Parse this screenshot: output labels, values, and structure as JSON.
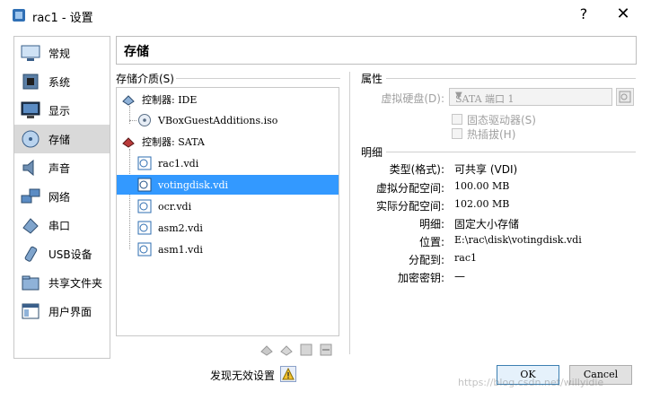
{
  "window": {
    "title": "rac1 - 设置",
    "help_label": "?",
    "close_label": "✕"
  },
  "sidebar": {
    "items": [
      {
        "label": "常规",
        "icon": "general-icon"
      },
      {
        "label": "系统",
        "icon": "system-icon"
      },
      {
        "label": "显示",
        "icon": "display-icon"
      },
      {
        "label": "存储",
        "icon": "storage-icon",
        "selected": true
      },
      {
        "label": "声音",
        "icon": "audio-icon"
      },
      {
        "label": "网络",
        "icon": "network-icon"
      },
      {
        "label": "串口",
        "icon": "serial-port-icon"
      },
      {
        "label": "USB设备",
        "icon": "usb-icon"
      },
      {
        "label": "共享文件夹",
        "icon": "shared-folder-icon"
      },
      {
        "label": "用户界面",
        "icon": "user-interface-icon"
      }
    ]
  },
  "page": {
    "title": "存储"
  },
  "storage": {
    "label": "存储介质(S)",
    "tree": [
      {
        "text": "控制器: IDE",
        "kind": "controller"
      },
      {
        "text": "VBoxGuestAdditions.iso",
        "kind": "optical"
      },
      {
        "text": "控制器: SATA",
        "kind": "controller"
      },
      {
        "text": "rac1.vdi",
        "kind": "disk"
      },
      {
        "text": "votingdisk.vdi",
        "kind": "disk",
        "selected": true
      },
      {
        "text": "ocr.vdi",
        "kind": "disk"
      },
      {
        "text": "asm2.vdi",
        "kind": "disk"
      },
      {
        "text": "asm1.vdi",
        "kind": "disk"
      }
    ]
  },
  "attributes": {
    "title": "属性",
    "hard_disk_label": "虚拟硬盘(D):",
    "hard_disk_value": "SATA 端口 1",
    "ssd_label": "固态驱动器(S)",
    "hotplug_label": "热插拔(H)"
  },
  "details": {
    "title": "明细",
    "rows": [
      {
        "key": "类型(格式):",
        "value": "可共享 (VDI)"
      },
      {
        "key": "虚拟分配空间:",
        "value": "100.00 MB"
      },
      {
        "key": "实际分配空间:",
        "value": "102.00 MB"
      },
      {
        "key": "明细:",
        "value": "固定大小存储"
      },
      {
        "key": "位置:",
        "value": "E:\\rac\\disk\\votingdisk.vdi"
      },
      {
        "key": "分配到:",
        "value": "rac1"
      },
      {
        "key": "加密密钥:",
        "value": "—"
      }
    ]
  },
  "footer": {
    "warning_label": "发现无效设置",
    "ok_label": "OK",
    "cancel_label": "Cancel"
  },
  "watermark": "https://blog.csdn.net/willyidie"
}
